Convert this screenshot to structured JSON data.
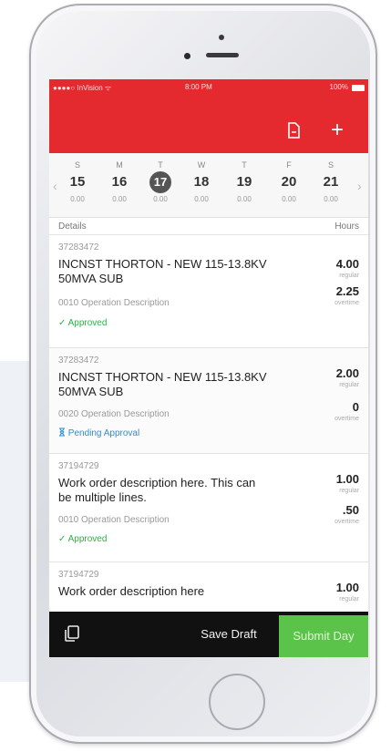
{
  "status_bar": {
    "carrier": "●●●●○ InVision ᯤ",
    "time": "8:00 PM",
    "battery": "100%"
  },
  "header": {
    "icons": [
      "document-icon",
      "plus-icon"
    ],
    "plus_label": "+",
    "color": "#e52a2f"
  },
  "week": {
    "days": [
      {
        "dow": "S",
        "date": "15",
        "hours": "0.00"
      },
      {
        "dow": "M",
        "date": "16",
        "hours": "0.00"
      },
      {
        "dow": "T",
        "date": "17",
        "hours": "0.00",
        "selected": true
      },
      {
        "dow": "W",
        "date": "18",
        "hours": "0.00"
      },
      {
        "dow": "T",
        "date": "19",
        "hours": "0.00"
      },
      {
        "dow": "F",
        "date": "20",
        "hours": "0.00"
      },
      {
        "dow": "S",
        "date": "21",
        "hours": "0.00"
      }
    ],
    "prev": "‹",
    "next": "›"
  },
  "columns": {
    "details": "Details",
    "hours": "Hours"
  },
  "entries": [
    {
      "wo": "37283472",
      "title": "INCNST THORTON - NEW 115-13.8KV 50MVA SUB",
      "op": "0010 Operation Description",
      "status": "✓ Approved",
      "status_type": "approved",
      "regular": "4.00",
      "regular_label": "regular",
      "overtime": "2.25",
      "overtime_label": "overtime"
    },
    {
      "wo": "37283472",
      "title": "INCNST THORTON - NEW 115-13.8KV 50MVA SUB",
      "op": "0020 Operation Description",
      "status": "Pending Approval",
      "status_type": "pending",
      "regular": "2.00",
      "regular_label": "regular",
      "overtime": "0",
      "overtime_label": "overtime"
    },
    {
      "wo": "37194729",
      "title": "Work order description here. This can be multiple lines.",
      "op": "0010 Operation Description",
      "status": "✓ Approved",
      "status_type": "approved",
      "regular": "1.00",
      "regular_label": "regular",
      "overtime": ".50",
      "overtime_label": "overtime"
    },
    {
      "wo": "37194729",
      "title": "Work order description here",
      "regular": "1.00",
      "regular_label": "regular"
    }
  ],
  "footer": {
    "save_draft": "Save Draft",
    "submit_day": "Submit Day",
    "submit_color": "#5bc34a"
  }
}
